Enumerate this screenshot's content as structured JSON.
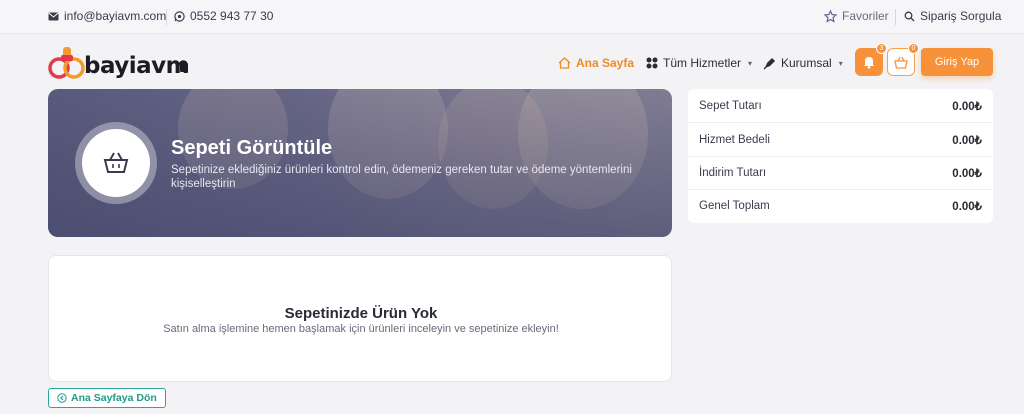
{
  "topbar": {
    "email": "info@bayiavm.com",
    "phone": "0552 943 77 30",
    "favorites": "Favoriler",
    "order_query": "Sipariş Sorgula"
  },
  "header": {
    "logo_text": "bayiavm",
    "nav": {
      "home": "Ana Sayfa",
      "services": "Tüm Hizmetler",
      "corporate": "Kurumsal"
    },
    "notification_count": "3",
    "cart_count": "0",
    "login_label": "Giriş Yap"
  },
  "hero": {
    "title": "Sepeti Görüntüle",
    "subtitle": "Sepetinize eklediğiniz ürünleri kontrol edin, ödemeniz gereken tutar ve ödeme yöntemlerini kişiselleştirin"
  },
  "summary": {
    "rows": [
      {
        "label": "Sepet Tutarı",
        "value": "0.00₺"
      },
      {
        "label": "Hizmet Bedeli",
        "value": "0.00₺"
      },
      {
        "label": "İndirim Tutarı",
        "value": "0.00₺"
      },
      {
        "label": "Genel Toplam",
        "value": "0.00₺"
      }
    ]
  },
  "empty_cart": {
    "title": "Sepetinizde Ürün Yok",
    "subtitle": "Satın alma işlemine hemen başlamak için ürünleri inceleyin ve sepetinize ekleyin!"
  },
  "back_label": "Ana Sayfaya Dön",
  "colors": {
    "accent": "#f7923a",
    "teal": "#1f9a8c",
    "hero": "#5b5d7e"
  }
}
